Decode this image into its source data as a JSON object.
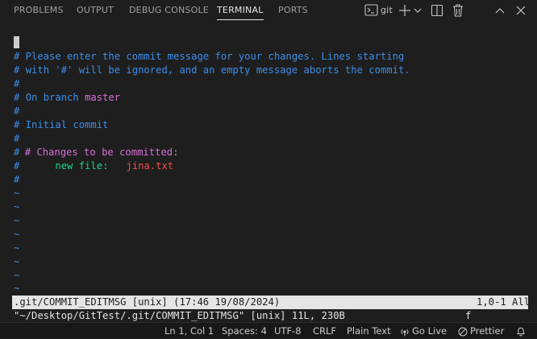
{
  "panel": {
    "tabs": [
      {
        "label": "PROBLEMS"
      },
      {
        "label": "OUTPUT"
      },
      {
        "label": "DEBUG CONSOLE"
      },
      {
        "label": "TERMINAL"
      },
      {
        "label": "PORTS"
      }
    ],
    "active_tab": "TERMINAL",
    "terminal_name": "git",
    "icons": [
      "terminal-icon",
      "plus-icon",
      "chevron-down-icon",
      "split-icon",
      "trash-icon",
      "maximize-icon",
      "close-icon"
    ]
  },
  "terminal": {
    "lines": [
      {
        "text": "# Please enter the commit message for your changes. Lines starting",
        "color": "#3b8eea"
      },
      {
        "text": "with '#' will be ignored, and an empty message aborts the commit.",
        "color": "#3b8eea"
      },
      {
        "text": "#",
        "color": "#3b8eea"
      },
      {
        "text": "On branch",
        "text2": "master"
      },
      {
        "text": "#",
        "color": "#3b8eea"
      },
      {
        "text": "# Initial commit",
        "color": "#3b8eea"
      },
      {
        "text": "#",
        "color": "#3b8eea"
      },
      {
        "text": "# Changes to be committed:",
        "color": "#d670d6"
      },
      {
        "text": "new file:",
        "text2": "jina.txt"
      },
      {
        "text": "#",
        "color": "#3b8eea"
      }
    ],
    "hash": "#",
    "tilde": "~",
    "status_left": ".git/COMMIT_EDITMSG [unix] (17:46 19/08/2024)",
    "status_right": "1,0-1 All",
    "message": "\"~/Desktop/GitTest/.git/COMMIT_EDITMSG\" [unix] 11L, 230B",
    "message_right": "f"
  },
  "statusbar": {
    "position": "Ln 1, Col 1",
    "spaces": "Spaces: 4",
    "encoding": "UTF-8",
    "eol": "CRLF",
    "language": "Plain Text",
    "golive": "Go Live",
    "prettier": "Prettier"
  },
  "colors": {
    "background": "#1e1e1e",
    "comment": "#3b8eea",
    "magenta": "#d670d6",
    "green": "#23d18b",
    "red": "#f14c4c"
  }
}
